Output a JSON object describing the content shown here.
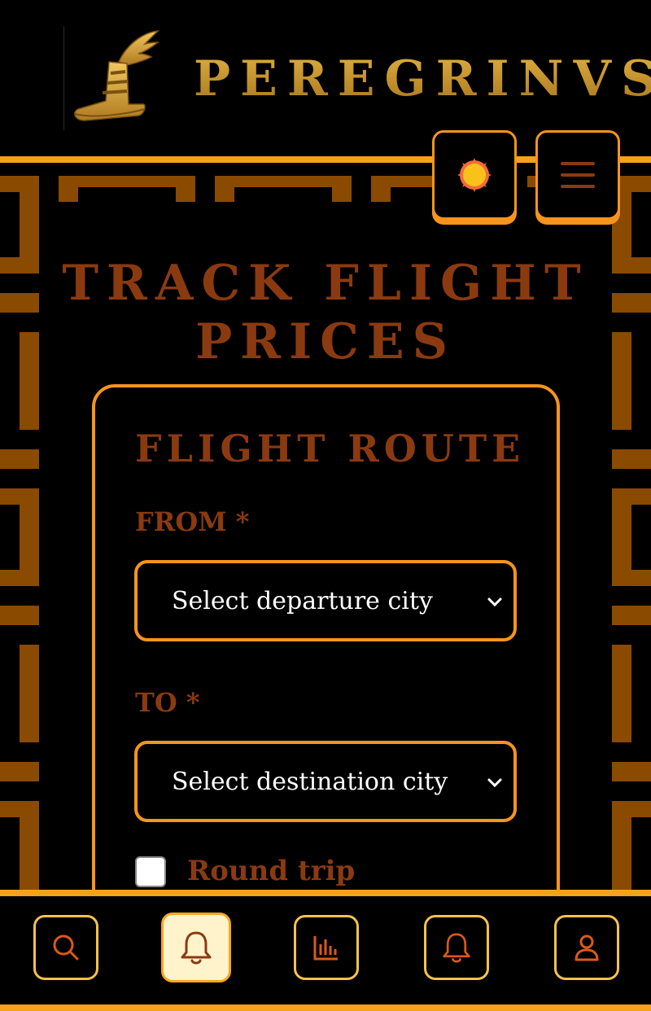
{
  "brand": {
    "name": "PEREGRINVS",
    "logo_icon": "winged-sandal-icon"
  },
  "header": {
    "theme_toggle_icon": "sun-icon",
    "menu_icon": "hamburger-menu-icon"
  },
  "page": {
    "title_line1": "TRACK FLIGHT",
    "title_line2": "PRICES"
  },
  "form": {
    "section_title": "FLIGHT ROUTE",
    "from_label": "FROM *",
    "from_value": "Select departure city",
    "to_label": "TO *",
    "to_value": "Select destination city",
    "round_trip_label": "Round trip",
    "round_trip_checked": false
  },
  "bottom_nav": [
    {
      "icon": "search-icon",
      "active": false
    },
    {
      "icon": "bell-icon",
      "active": true
    },
    {
      "icon": "bar-chart-icon",
      "active": false
    },
    {
      "icon": "bell-icon",
      "active": false
    },
    {
      "icon": "user-icon",
      "active": false
    }
  ],
  "colors": {
    "accent": "#f7941d",
    "title_brown": "#8b3a10",
    "pattern_brown": "#8a4a00",
    "gold": "#c8942a",
    "nav_border": "#f5c24a"
  }
}
